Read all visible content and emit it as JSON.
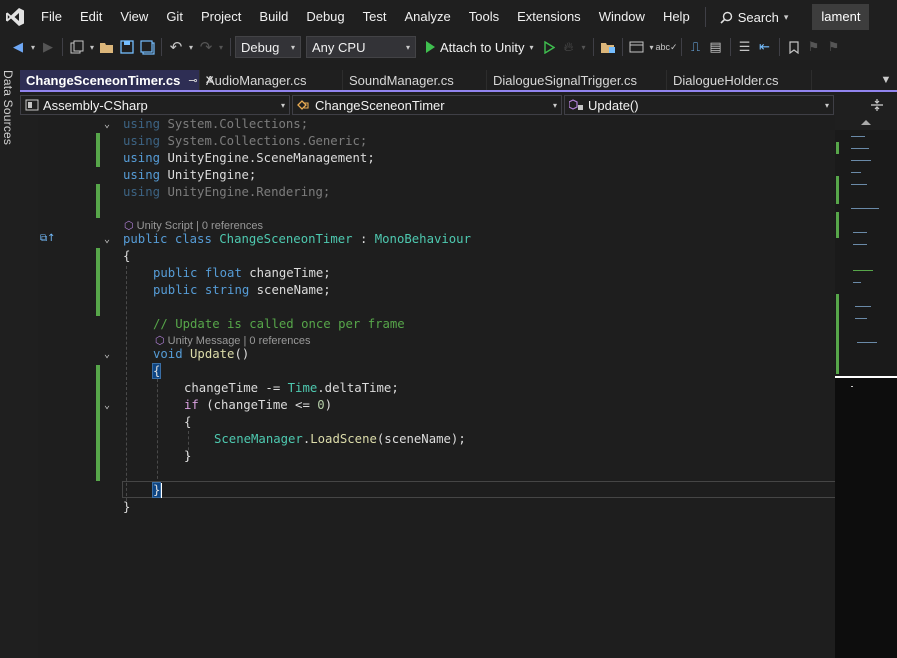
{
  "menubar": {
    "items": [
      "File",
      "Edit",
      "View",
      "Git",
      "Project",
      "Build",
      "Debug",
      "Test",
      "Analyze",
      "Tools",
      "Extensions",
      "Window",
      "Help"
    ],
    "search_label": "Search",
    "solution_name": "lament"
  },
  "toolbar": {
    "configuration": "Debug",
    "platform": "Any CPU",
    "attach_label": "Attach to Unity"
  },
  "side_panel": {
    "label": "Data Sources"
  },
  "tabs": [
    {
      "label": "ChangeSceneonTimer.cs",
      "active": true
    },
    {
      "label": "AudioManager.cs",
      "active": false
    },
    {
      "label": "SoundManager.cs",
      "active": false
    },
    {
      "label": "DialogueSignalTrigger.cs",
      "active": false
    },
    {
      "label": "DialogueHolder.cs",
      "active": false
    }
  ],
  "navbar": {
    "project": "Assembly-CSharp",
    "class": "ChangeSceneonTimer",
    "member": "Update()"
  },
  "code": {
    "using1_kw": "using",
    "using1_ns": "System.Collections;",
    "using2_kw": "using",
    "using2_ns": "System.Collections.Generic;",
    "using3_kw": "using",
    "using3_ns": "UnityEngine.SceneManagement;",
    "using4_kw": "using",
    "using4_ns": "UnityEngine;",
    "using5_kw": "using",
    "using5_ns": "UnityEngine.Rendering;",
    "lens_class": "Unity Script | 0 references",
    "class_kw1": "public",
    "class_kw2": "class",
    "class_name": "ChangeSceneonTimer",
    "class_colon": ":",
    "class_base": "MonoBehaviour",
    "brace_open": "{",
    "field1_kw1": "public",
    "field1_kw2": "float",
    "field1_name": "changeTime;",
    "field2_kw1": "public",
    "field2_kw2": "string",
    "field2_name": "sceneName;",
    "comment": "// Update is called once per frame",
    "lens_method": "Unity Message | 0 references",
    "method_kw": "void",
    "method_name": "Update",
    "method_parens": "()",
    "m_brace_open": "{",
    "stmt1_a": "changeTime -= ",
    "stmt1_ty": "Time",
    "stmt1_b": ".deltaTime;",
    "if_kw": "if",
    "if_a": " (changeTime <= ",
    "if_num": "0",
    "if_b": ")",
    "if_brace_open": "{",
    "call_ty": "SceneManager",
    "call_dot": ".",
    "call_meth": "LoadScene",
    "call_args": "(sceneName);",
    "if_brace_close": "}",
    "m_brace_close": "}",
    "brace_close": "}"
  },
  "colors": {
    "keyword": "#569cd6",
    "type": "#4ec9b0",
    "comment": "#57a64a",
    "method": "#dcdcaa",
    "control": "#d8a0df",
    "number": "#b5cea8",
    "change_bar": "#57a64a",
    "tab_accent": "#9184ee"
  }
}
